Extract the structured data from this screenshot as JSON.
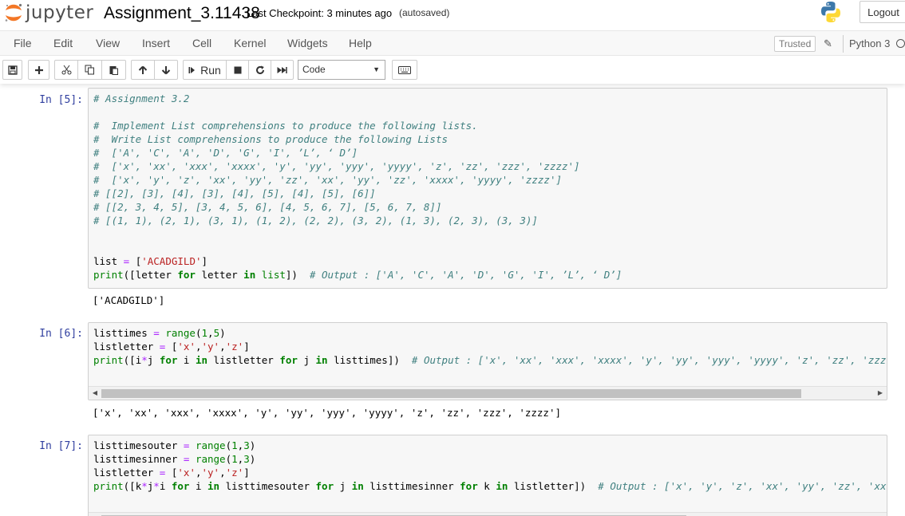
{
  "header": {
    "logo_text": "jupyter",
    "notebook_title": "Assignment_3.11438",
    "checkpoint": "Last Checkpoint: 3 minutes ago",
    "autosave": "(autosaved)",
    "logout_label": "Logout"
  },
  "menu": {
    "items": [
      "File",
      "Edit",
      "View",
      "Insert",
      "Cell",
      "Kernel",
      "Widgets",
      "Help"
    ],
    "trusted": "Trusted",
    "kernel_name": "Python 3"
  },
  "toolbar": {
    "run_label": "Run",
    "cell_type": "Code"
  },
  "cells": [
    {
      "prompt": "In [5]:",
      "output": "['ACADGILD']"
    },
    {
      "prompt": "In [6]:",
      "output": "['x', 'xx', 'xxx', 'xxxx', 'y', 'yy', 'yyy', 'yyyy', 'z', 'zz', 'zzz', 'zzzz']"
    },
    {
      "prompt": "In [7]:",
      "output": ""
    }
  ],
  "code": {
    "c5_l1": "# Assignment 3.2",
    "c5_l3": "#  Implement List comprehensions to produce the following lists.",
    "c5_l4": "#  Write List comprehensions to produce the following Lists",
    "c5_l5": "#  ['A', 'C', 'A', 'D', 'G', 'I', ’L’, ‘ D’]",
    "c5_l6": "#  ['x', 'xx', 'xxx', 'xxxx', 'y', 'yy', 'yyy', 'yyyy', 'z', 'zz', 'zzz', 'zzzz']",
    "c5_l7": "#  ['x', 'y', 'z', 'xx', 'yy', 'zz', 'xx', 'yy', 'zz', 'xxxx', 'yyyy', 'zzzz']",
    "c5_l8": "# [[2], [3], [4], [3], [4], [5], [4], [5], [6]]",
    "c5_l9": "# [[2, 3, 4, 5], [3, 4, 5, 6], [4, 5, 6, 7], [5, 6, 7, 8]]",
    "c5_l10": "# [(1, 1), (2, 1), (3, 1), (1, 2), (2, 2), (3, 2), (1, 3), (2, 3), (3, 3)]",
    "c5_l13_var": "list",
    "c5_l13_str": "'ACADGILD'",
    "c5_l14_comment": "# Output : ['A', 'C', 'A', 'D', 'G', 'I', ’L’, ‘ D’]",
    "c6_l3_comment": "# Output : ['x', 'xx', 'xxx', 'xxxx', 'y', 'yy', 'yyy', 'yyyy', 'z', 'zz', 'zzz', 'zzzz']",
    "c7_l4_comment": "# Output : ['x', 'y', 'z', 'xx', 'yy', 'zz', 'xx', 'yy', 'zz', 'xxxx', 'yyyy', 'zzzz']"
  }
}
